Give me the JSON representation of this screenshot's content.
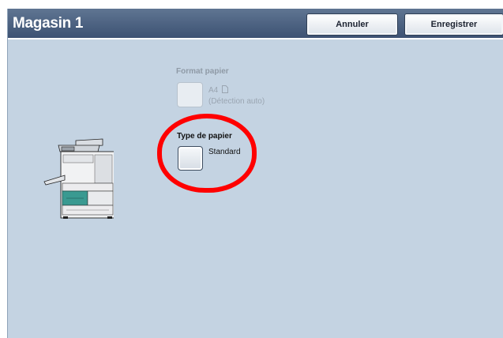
{
  "window": {
    "title": "Magasin 1"
  },
  "toolbar": {
    "cancel_label": "Annuler",
    "save_label": "Enregistrer"
  },
  "paper_format": {
    "label": "Format papier",
    "size": "A4",
    "detection": "(Détection auto)",
    "enabled": false,
    "orientation_icon": "portrait-page-icon"
  },
  "paper_type": {
    "label": "Type de papier",
    "value": "Standard",
    "highlighted": true
  },
  "illustration": {
    "icon": "printer-icon",
    "highlight_tray_color": "#3a9a91"
  },
  "colors": {
    "title_bar": "#4a6082",
    "background": "#c4d3e2",
    "highlight_ring": "#ff0000"
  }
}
